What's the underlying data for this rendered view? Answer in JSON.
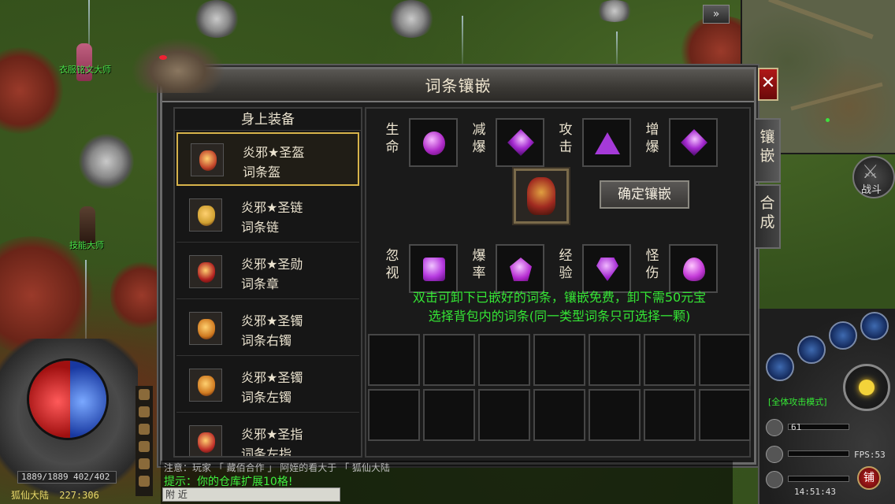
{
  "world": {
    "npc_costume": "衣服铭文大师",
    "npc_skill": "技能大师"
  },
  "minimap": {
    "toggle_label": "»",
    "battle_label": "战斗"
  },
  "dialog": {
    "title": "词条镶嵌",
    "close_label": "✕",
    "tabs": [
      {
        "label": "镶\n嵌"
      },
      {
        "label": "合\n成"
      }
    ],
    "equipment": {
      "header": "身上装备",
      "items": [
        {
          "name": "炎邪★圣盔",
          "sub": "词条盔",
          "color": "#c0442a"
        },
        {
          "name": "炎邪★圣链",
          "sub": "词条链",
          "color": "#d0a030"
        },
        {
          "name": "炎邪★圣勋",
          "sub": "词条章",
          "color": "#b02020"
        },
        {
          "name": "炎邪★圣镯",
          "sub": "词条右镯",
          "color": "#d07a20"
        },
        {
          "name": "炎邪★圣镯",
          "sub": "词条左镯",
          "color": "#d07a20"
        },
        {
          "name": "炎邪★圣指",
          "sub": "词条左指",
          "color": "#c0302a"
        }
      ]
    },
    "slots_top": [
      {
        "label": "生\n命",
        "gem": "round"
      },
      {
        "label": "减\n爆",
        "gem": "diamond"
      },
      {
        "label": "攻\n击",
        "gem": "tri"
      },
      {
        "label": "增\n爆",
        "gem": "diamond"
      }
    ],
    "slots_bottom": [
      {
        "label": "忽\n视",
        "gem": "square"
      },
      {
        "label": "爆\n率",
        "gem": "penta"
      },
      {
        "label": "经\n验",
        "gem": "gemcut"
      },
      {
        "label": "怪\n伤",
        "gem": "drop"
      }
    ],
    "confirm_label": "确定镶嵌",
    "hint1": "双击可卸下已嵌好的词条，镶嵌免费，卸下需50元宝",
    "hint2": "选择背包内的词条(同一类型词条只可选择一颗)"
  },
  "hud": {
    "hp": "1889/1889",
    "mp": "402/402",
    "map_name": "狐仙大陆",
    "coords": "227:306",
    "chat_line1": "注意：玩家 「 藏佰合作 」 阿姪的看大于 「 狐仙大陆",
    "chat_line2": "提示：你的仓库扩展10格!",
    "chat_channel": "附 近",
    "attack_mode": "[全体攻击模式]",
    "level": "61",
    "fps": "FPS:53",
    "time": "14:51:43",
    "shop_label": "铺"
  }
}
